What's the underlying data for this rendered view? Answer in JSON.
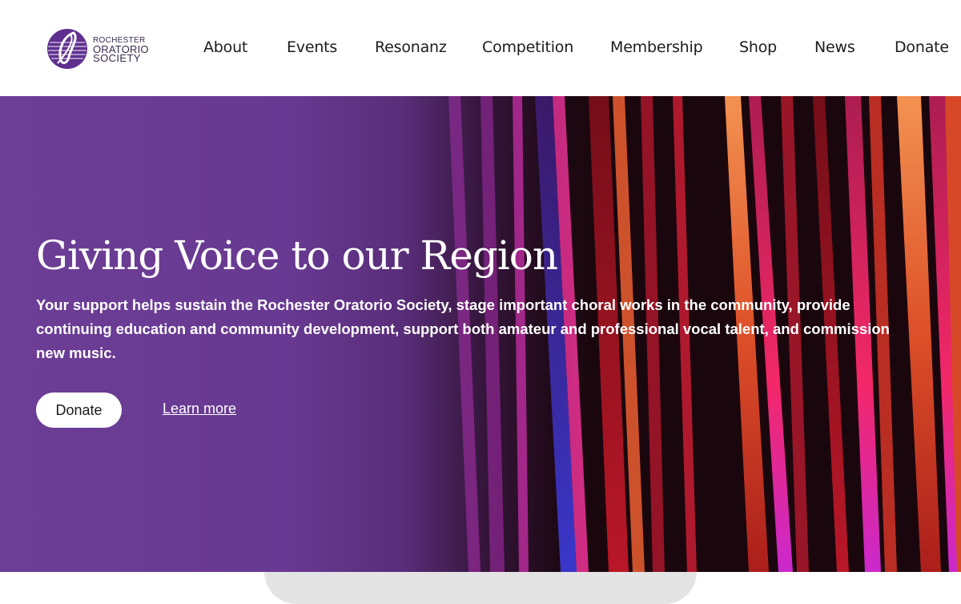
{
  "logo": {
    "line1": "ROCHESTER",
    "line2": "ORATORIO",
    "line3": "SOCIETY",
    "mark_color": "#5f2f8f"
  },
  "nav": {
    "items": [
      {
        "label": "About"
      },
      {
        "label": "Events"
      },
      {
        "label": "Resonanz"
      },
      {
        "label": "Competition"
      },
      {
        "label": "Membership"
      },
      {
        "label": "Shop"
      },
      {
        "label": "News"
      },
      {
        "label": "Donate"
      }
    ]
  },
  "hero": {
    "title": "Giving Voice to our Region",
    "text": "Your support helps sustain the Rochester Oratorio Society, stage important choral works in the community, provide continuing education and community development, support both amateur and professional vocal talent, and commission new music.",
    "donate_label": "Donate",
    "learn_more_label": "Learn more",
    "overlay_color": "#6c3e96"
  }
}
